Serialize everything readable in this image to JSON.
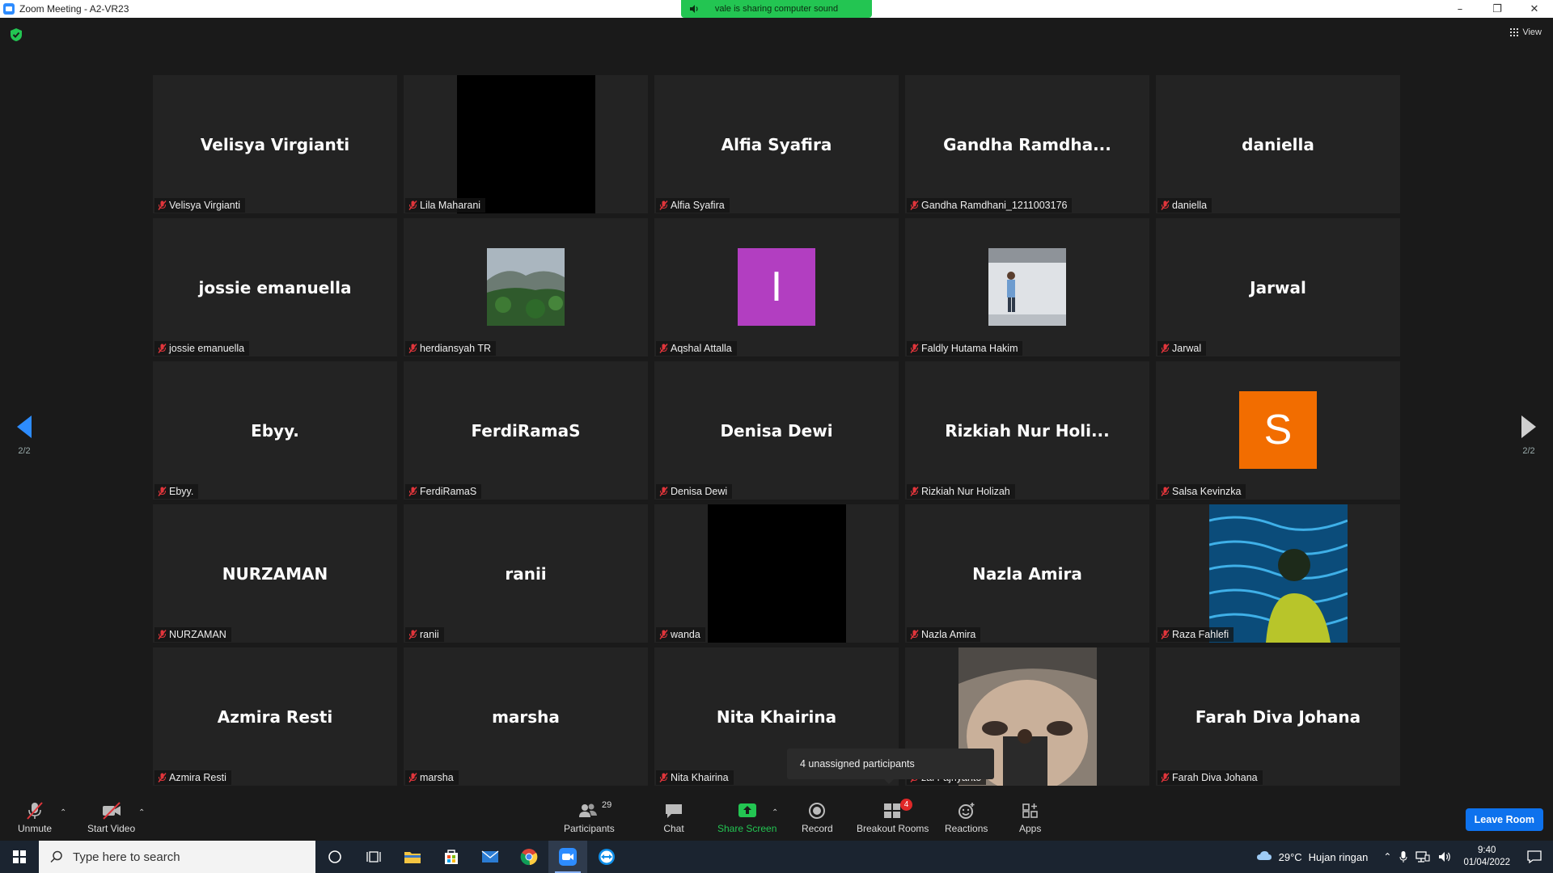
{
  "window": {
    "title": "Zoom Meeting - A2-VR23"
  },
  "share_banner": {
    "text": "vale is sharing computer sound"
  },
  "view_button": {
    "label": "View"
  },
  "pagination": {
    "left": "2/2",
    "right": "2/2"
  },
  "tiles": [
    {
      "big": "Velisya Virgianti",
      "label": "Velisya Virgianti"
    },
    {
      "big": "",
      "label": "Lila Maharani"
    },
    {
      "big": "Alfia Syafira",
      "label": "Alfia Syafira"
    },
    {
      "big": "Gandha  Ramdha...",
      "label": "Gandha Ramdhani_1211003176"
    },
    {
      "big": "daniella",
      "label": "daniella"
    },
    {
      "big": "jossie emanuella",
      "label": "jossie emanuella"
    },
    {
      "big": "",
      "label": "herdiansyah TR"
    },
    {
      "big": "",
      "avatar": "I",
      "label": "Aqshal Attalla"
    },
    {
      "big": "",
      "label": "Faldly Hutama Hakim"
    },
    {
      "big": "Jarwal",
      "label": "Jarwal"
    },
    {
      "big": "Ebyy.",
      "label": "Ebyy."
    },
    {
      "big": "FerdiRamaS",
      "label": "FerdiRamaS"
    },
    {
      "big": "Denisa Dewi",
      "label": "Denisa Dewi"
    },
    {
      "big": "Rizkiah  Nur  Holi...",
      "label": "Rizkiah Nur Holizah"
    },
    {
      "big": "",
      "avatar": "S",
      "label": "Salsa Kevinzka"
    },
    {
      "big": "NURZAMAN",
      "label": "NURZAMAN"
    },
    {
      "big": "ranii",
      "label": "ranii"
    },
    {
      "big": "",
      "label": "wanda"
    },
    {
      "big": "Nazla Amira",
      "label": "Nazla Amira"
    },
    {
      "big": "",
      "label": "Raza Fahlefi"
    },
    {
      "big": "Azmira Resti",
      "label": "Azmira Resti"
    },
    {
      "big": "marsha",
      "label": "marsha"
    },
    {
      "big": "Nita Khairina",
      "label": "Nita Khairina"
    },
    {
      "big": "",
      "label": "zal Fajriyanto"
    },
    {
      "big": "Farah Diva Johana",
      "label": "Farah Diva Johana"
    }
  ],
  "tooltip": {
    "text": "4 unassigned participants"
  },
  "toolbar": {
    "unmute": "Unmute",
    "start_video": "Start Video",
    "participants": "Participants",
    "participants_count": "29",
    "chat": "Chat",
    "share_screen": "Share Screen",
    "record": "Record",
    "breakout_rooms": "Breakout Rooms",
    "breakout_badge": "4",
    "reactions": "Reactions",
    "apps": "Apps",
    "leave": "Leave Room"
  },
  "taskbar": {
    "search_placeholder": "Type here to search",
    "temperature": "29°C",
    "weather": "Hujan ringan",
    "time": "9:40",
    "date": "01/04/2022"
  },
  "colors": {
    "accent": "#2d8cff",
    "share_green": "#23c552",
    "leave_blue": "#0e72ed",
    "mute_red": "#e0353b",
    "avatar_purple": "#b23ec1",
    "avatar_orange": "#f26d00"
  }
}
